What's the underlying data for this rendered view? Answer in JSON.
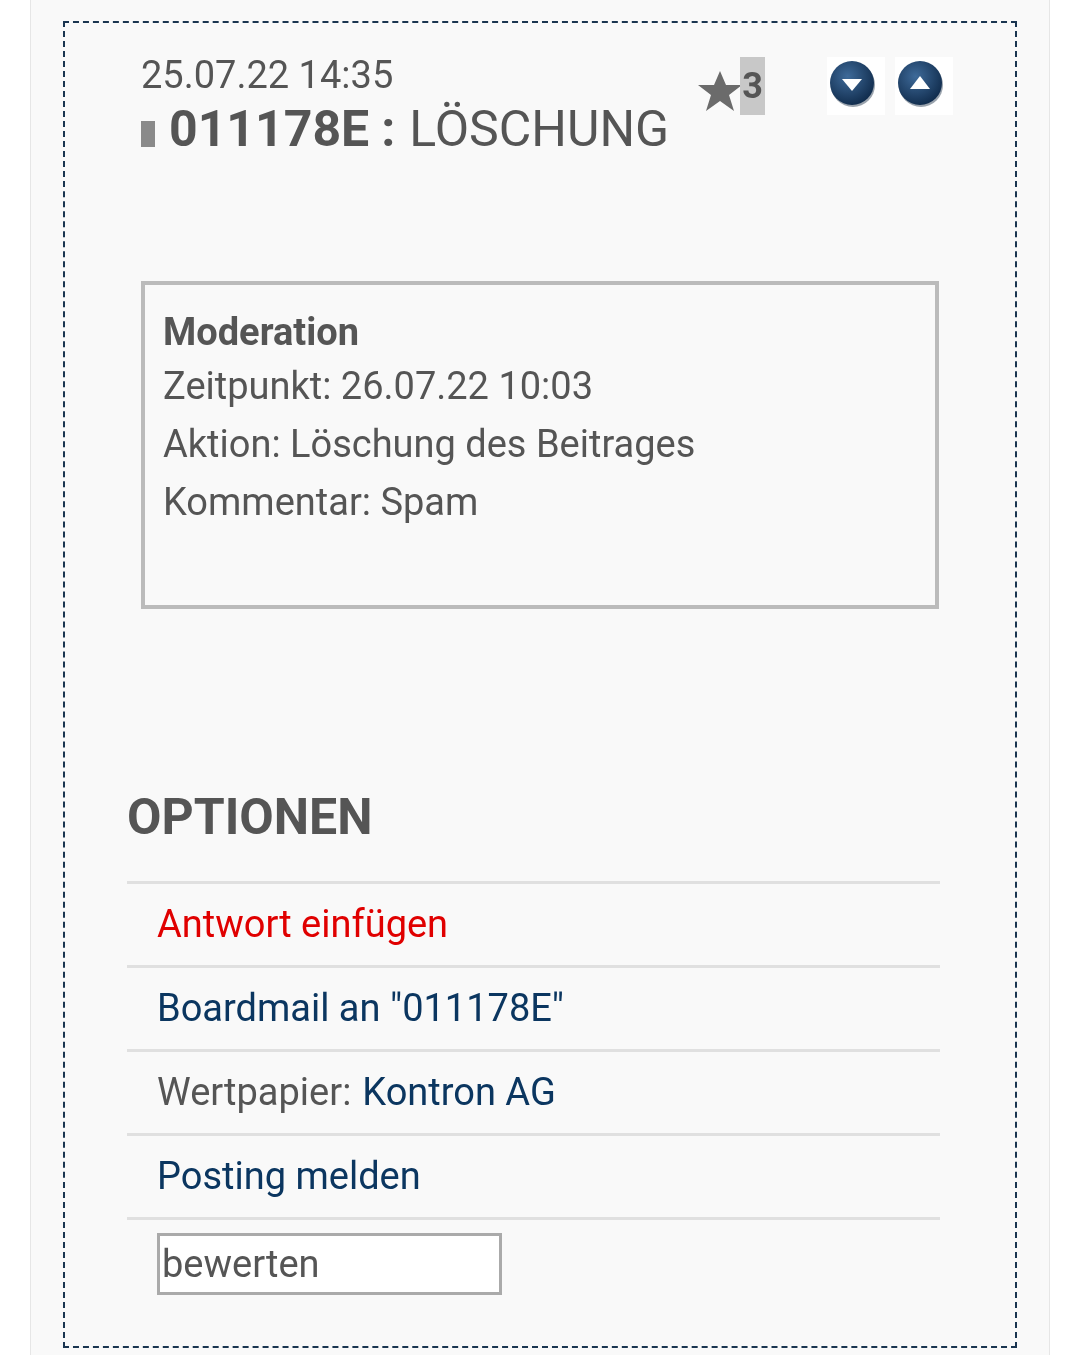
{
  "post": {
    "timestamp": "25.07.22 14:35",
    "author": "011178E",
    "separator": ":",
    "subject": "LÖSCHUNG",
    "rating_count": "3"
  },
  "moderation": {
    "title": "Moderation",
    "lines": [
      "Zeitpunkt: 26.07.22 10:03",
      "Aktion: Löschung des Beitrages",
      "Kommentar: Spam"
    ]
  },
  "options": {
    "title": "OPTIONEN",
    "items": [
      {
        "kind": "action",
        "text": "Antwort einfügen"
      },
      {
        "kind": "link",
        "text": "Boardmail an \"011178E\""
      },
      {
        "kind": "labeled",
        "label": "Wertpapier:",
        "text": "Kontron AG"
      },
      {
        "kind": "link",
        "text": "Posting melden"
      }
    ],
    "rating_field": {
      "value": "bewerten"
    }
  }
}
